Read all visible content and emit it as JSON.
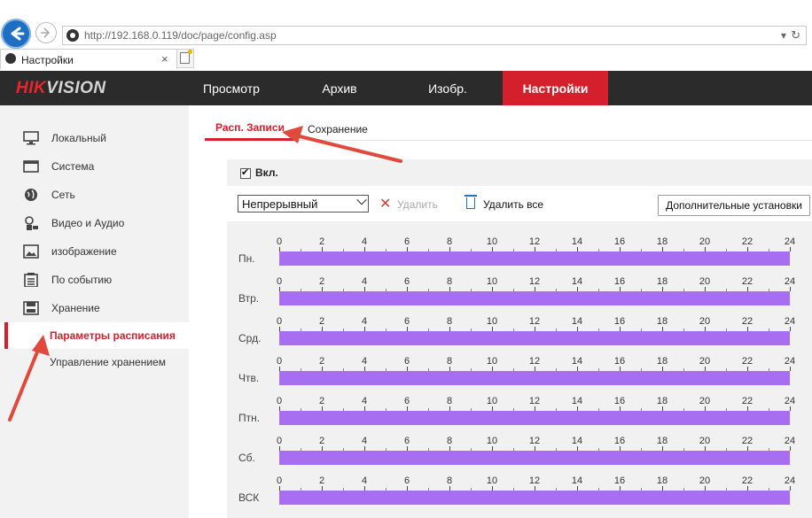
{
  "browser": {
    "url": "http://192.168.0.119/doc/page/config.asp",
    "tab_title": "Настройки",
    "tab_close": "×"
  },
  "header": {
    "logo_hik": "HIK",
    "logo_vision": "VISION",
    "nav": [
      {
        "label": "Просмотр"
      },
      {
        "label": "Архив"
      },
      {
        "label": "Изобр."
      },
      {
        "label": "Настройки",
        "active": true
      }
    ]
  },
  "sidebar": {
    "items": [
      {
        "label": "Локальный",
        "icon": "monitor-icon"
      },
      {
        "label": "Система",
        "icon": "system-window-icon"
      },
      {
        "label": "Сеть",
        "icon": "globe-icon"
      },
      {
        "label": "Видео и Аудио",
        "icon": "mic-camera-icon"
      },
      {
        "label": "изображение",
        "icon": "image-icon"
      },
      {
        "label": "По событию",
        "icon": "event-list-icon"
      },
      {
        "label": "Хранение",
        "icon": "disk-icon"
      }
    ],
    "sub_items": [
      {
        "label": "Параметры расписания",
        "active": true
      },
      {
        "label": "Управление хранением"
      }
    ]
  },
  "subtabs": [
    {
      "label": "Расп. Записи",
      "active": true
    },
    {
      "label": "Сохранение"
    }
  ],
  "schedule": {
    "enable_label": "Вкл.",
    "enabled": true,
    "mode_value": "Непрерывный",
    "delete_label": "Удалить",
    "delete_all_label": "Удалить все",
    "advanced_label": "Дополнительные установки",
    "hours": [
      "0",
      "2",
      "4",
      "6",
      "8",
      "10",
      "12",
      "14",
      "16",
      "18",
      "20",
      "22",
      "24"
    ],
    "days": [
      "Пн.",
      "Втр.",
      "Срд.",
      "Чтв.",
      "Птн.",
      "Сб.",
      "ВСК"
    ],
    "bar_color": "#a76ef2",
    "coverage": [
      1,
      1,
      1,
      1,
      1,
      1,
      1
    ]
  },
  "colors": {
    "accent": "#d4202c",
    "header_bg": "#2b2b2b",
    "annotation": "#e04a3c"
  }
}
